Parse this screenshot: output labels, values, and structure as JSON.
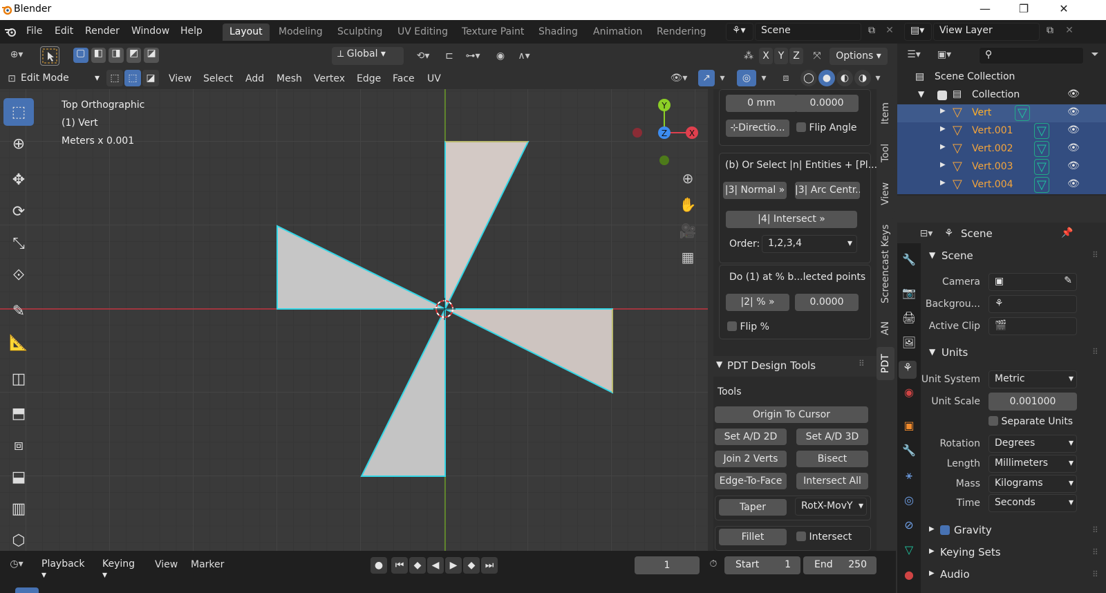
{
  "window": {
    "title": "Blender",
    "minimize": "—",
    "restore": "❐",
    "close": "✕"
  },
  "menu": {
    "file": "File",
    "edit": "Edit",
    "render": "Render",
    "window": "Window",
    "help": "Help"
  },
  "workspaces": [
    "Layout",
    "Modeling",
    "Sculpting",
    "UV Editing",
    "Texture Paint",
    "Shading",
    "Animation",
    "Rendering"
  ],
  "scene": {
    "name": "Scene",
    "view_layer": "View Layer"
  },
  "header": {
    "transform_orientation": "Global",
    "axis_x": "X",
    "axis_y": "Y",
    "axis_z": "Z",
    "options": "Options",
    "mode": "Edit Mode",
    "menus": [
      "View",
      "Select",
      "Add",
      "Mesh",
      "Vertex",
      "Edge",
      "Face",
      "UV"
    ]
  },
  "viewport": {
    "view_name": "Top Orthographic",
    "object_info": "(1) Vert",
    "scale_info": "Meters x 0.001",
    "gizmo_y": "Y",
    "gizmo_z": "Z",
    "gizmo_x": "X"
  },
  "npanel": {
    "field_distance": "0 mm",
    "field_angle": "0.0000",
    "direction_btn": "Directio...",
    "flip_angle": "Flip Angle",
    "select_hint": "(b) Or Select |n| Entities + [Pl...",
    "normal_btn": "|3| Normal »",
    "arc_btn": "|3| Arc Centr...",
    "intersect_btn": "|4| Intersect »",
    "order_label": "Order:",
    "order_value": "1,2,3,4",
    "percent_hint": "Do (1) at % b...lected points",
    "percent_btn": "|2| % »",
    "percent_value": "0.0000",
    "flip_percent": "Flip %",
    "design_tools_title": "PDT Design Tools",
    "tools_label": "Tools",
    "origin_to_cursor": "Origin To Cursor",
    "set_ad_2d": "Set A/D 2D",
    "set_ad_3d": "Set A/D 3D",
    "join_2_verts": "Join 2 Verts",
    "bisect": "Bisect",
    "edge_to_face": "Edge-To-Face",
    "intersect_all": "Intersect All",
    "taper": "Taper",
    "taper_mode": "RotX-MovY",
    "fillet": "Fillet",
    "intersect": "Intersect",
    "tabs": [
      "Item",
      "Tool",
      "View",
      "Screencast Keys",
      "AN",
      "PDT"
    ]
  },
  "outliner": {
    "scene_collection": "Scene Collection",
    "collection": "Collection",
    "objects": [
      "Vert",
      "Vert.001",
      "Vert.002",
      "Vert.003",
      "Vert.004"
    ]
  },
  "properties": {
    "context": "Scene",
    "scene_section": "Scene",
    "camera_label": "Camera",
    "background_label": "Backgrou...",
    "active_clip_label": "Active Clip",
    "units_section": "Units",
    "unit_system_label": "Unit System",
    "unit_system_value": "Metric",
    "unit_scale_label": "Unit Scale",
    "unit_scale_value": "0.001000",
    "separate_units": "Separate Units",
    "rotation_label": "Rotation",
    "rotation_value": "Degrees",
    "length_label": "Length",
    "length_value": "Millimeters",
    "mass_label": "Mass",
    "mass_value": "Kilograms",
    "time_label": "Time",
    "time_value": "Seconds",
    "gravity": "Gravity",
    "keying_sets": "Keying Sets",
    "audio": "Audio"
  },
  "timeline": {
    "playback": "Playback",
    "keying": "Keying",
    "view": "View",
    "marker": "Marker",
    "current_frame": "1",
    "start_label": "Start",
    "start_value": "1",
    "end_label": "End",
    "end_value": "250"
  },
  "colors": {
    "accent": "#4772b3",
    "selection_outline": "#33d6e6",
    "face": "#c7c7c7",
    "x_axis": "#c2323e",
    "y_axis": "#6a9a26"
  }
}
